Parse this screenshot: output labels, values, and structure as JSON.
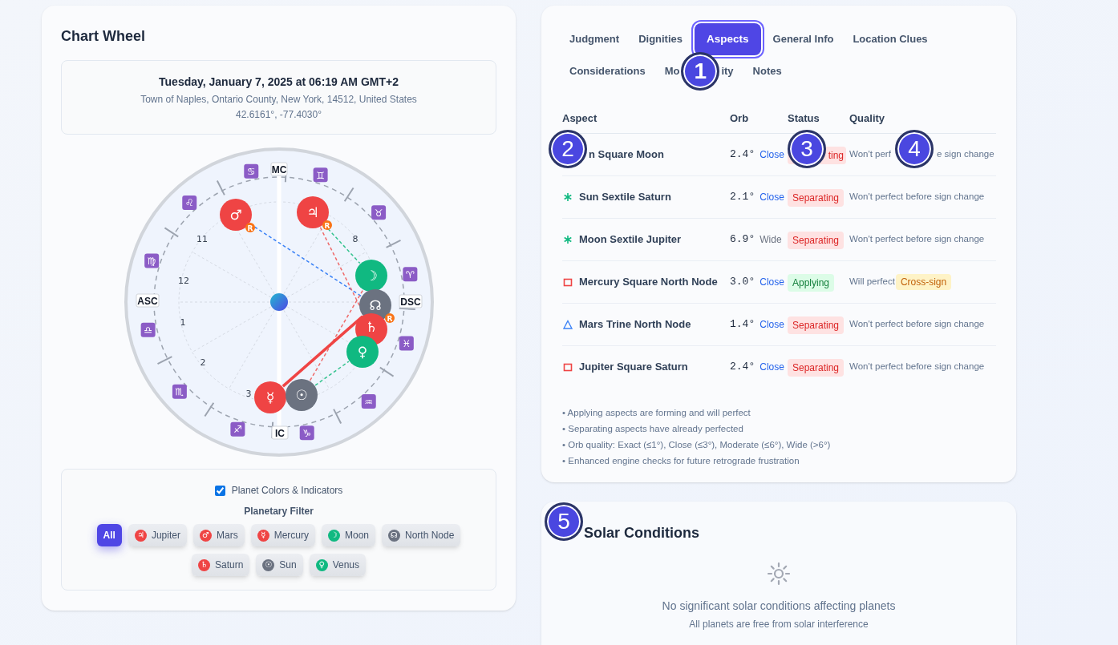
{
  "chart_wheel": {
    "title": "Chart Wheel",
    "info": {
      "datetime": "Tuesday, January 7, 2025 at 06:19 AM GMT+2",
      "place": "Town of Naples, Ontario County, New York, 14512, United States",
      "coords": "42.6161°, -77.4030°"
    },
    "zodiac": [
      "♈",
      "♉",
      "♊",
      "♋",
      "♌",
      "♍",
      "♎",
      "♏",
      "♐",
      "♑",
      "♒",
      "♓"
    ],
    "angles": [
      "MC",
      "ASC",
      "DSC",
      "IC"
    ],
    "houses": [
      "11",
      "12",
      "1",
      "2",
      "3",
      "8"
    ],
    "planets": [
      {
        "glyph": "♂",
        "color": "#ef4444",
        "badge": "R"
      },
      {
        "glyph": "♃",
        "color": "#ef4444",
        "badge": "R"
      },
      {
        "glyph": "☽",
        "color": "#10b981"
      },
      {
        "glyph": "☊",
        "color": "#6b7280",
        "badge": "R"
      },
      {
        "glyph": "♄",
        "color": "#ef4444"
      },
      {
        "glyph": "♀",
        "color": "#10b981"
      },
      {
        "glyph": "☿",
        "color": "#ef4444"
      },
      {
        "glyph": "☉",
        "color": "#6b7280"
      }
    ],
    "indicators": {
      "label": "Planet Colors & Indicators",
      "checked": true
    },
    "filter": {
      "title": "Planetary Filter",
      "buttons": [
        {
          "label": "All",
          "selected": true
        },
        {
          "label": "Jupiter",
          "glyph": "♃",
          "color": "#ef4444",
          "selected": false
        },
        {
          "label": "Mars",
          "glyph": "♂",
          "color": "#ef4444",
          "selected": false
        },
        {
          "label": "Mercury",
          "glyph": "☿",
          "color": "#ef4444",
          "selected": false
        },
        {
          "label": "Moon",
          "glyph": "☽",
          "color": "#10b981",
          "selected": false
        },
        {
          "label": "North Node",
          "glyph": "☊",
          "color": "#6b7280",
          "selected": false
        },
        {
          "label": "Saturn",
          "glyph": "♄",
          "color": "#ef4444",
          "selected": false
        },
        {
          "label": "Sun",
          "glyph": "☉",
          "color": "#6b7280",
          "selected": false
        },
        {
          "label": "Venus",
          "glyph": "♀",
          "color": "#10b981",
          "selected": false
        }
      ]
    }
  },
  "tabs": [
    {
      "label": "Judgment",
      "selected": false
    },
    {
      "label": "Dignities",
      "selected": false
    },
    {
      "label": "Aspects",
      "selected": true
    },
    {
      "label": "General Info",
      "selected": false
    },
    {
      "label": "Location Clues",
      "selected": false
    },
    {
      "label": "Considerations",
      "selected": false
    },
    {
      "label_start": "Mo",
      "label_end": "ity",
      "selected": false
    },
    {
      "label": "Notes",
      "selected": false
    }
  ],
  "aspects_table": {
    "columns": [
      "Aspect",
      "Orb",
      "Status",
      "Quality"
    ],
    "rows": [
      {
        "aspect": "n Square Moon",
        "orb": "2.4°",
        "orb_quality": {
          "text": "Close",
          "color": "#2563eb"
        },
        "status": {
          "text": "ting",
          "color": "#fee2e2"
        },
        "quality_start": "Won't perf",
        "quality_end": "e sign change"
      },
      {
        "kind": "sextile",
        "aspect": "Sun Sextile Saturn",
        "orb": "2.1°",
        "orb_quality": {
          "text": "Close",
          "color": "#2563eb"
        },
        "status": {
          "text": "Separating",
          "color": "#fee2e2"
        },
        "quality": "Won't perfect before sign change"
      },
      {
        "kind": "sextile",
        "aspect": "Moon Sextile Jupiter",
        "orb": "6.9°",
        "orb_quality": {
          "text": "Wide",
          "color": "#6b7280"
        },
        "status": {
          "text": "Separating",
          "color": "#fee2e2"
        },
        "quality": "Won't perfect before sign change"
      },
      {
        "kind": "square",
        "aspect": "Mercury Square North Node",
        "orb": "3.0°",
        "orb_quality": {
          "text": "Close",
          "color": "#2563eb"
        },
        "status": {
          "text": "Applying",
          "color": "#dcfce7"
        },
        "quality": "Will perfect",
        "tag": "Cross-sign"
      },
      {
        "kind": "trine",
        "aspect": "Mars Trine North Node",
        "orb": "1.4°",
        "orb_quality": {
          "text": "Close",
          "color": "#2563eb"
        },
        "status": {
          "text": "Separating",
          "color": "#fee2e2"
        },
        "quality": "Won't perfect before sign change"
      },
      {
        "kind": "square",
        "aspect": "Jupiter Square Saturn",
        "orb": "2.4°",
        "orb_quality": {
          "text": "Close",
          "color": "#2563eb"
        },
        "status": {
          "text": "Separating",
          "color": "#fee2e2"
        },
        "quality": "Won't perfect before sign change"
      }
    ],
    "notes": [
      "• Applying aspects are forming and will perfect",
      "• Separating aspects have already perfected",
      "• Orb quality: Exact (≤1°), Close (≤3°), Moderate (≤6°), Wide (>6°)",
      "• Enhanced engine checks for future retrograde frustration"
    ]
  },
  "solar_conditions": {
    "title": "Solar Conditions",
    "message": "No significant solar conditions affecting planets",
    "detail": "All planets are free from solar interference"
  },
  "callouts": [
    {
      "number": "1"
    },
    {
      "number": "2"
    },
    {
      "number": "3"
    },
    {
      "number": "4"
    },
    {
      "number": "5"
    }
  ]
}
